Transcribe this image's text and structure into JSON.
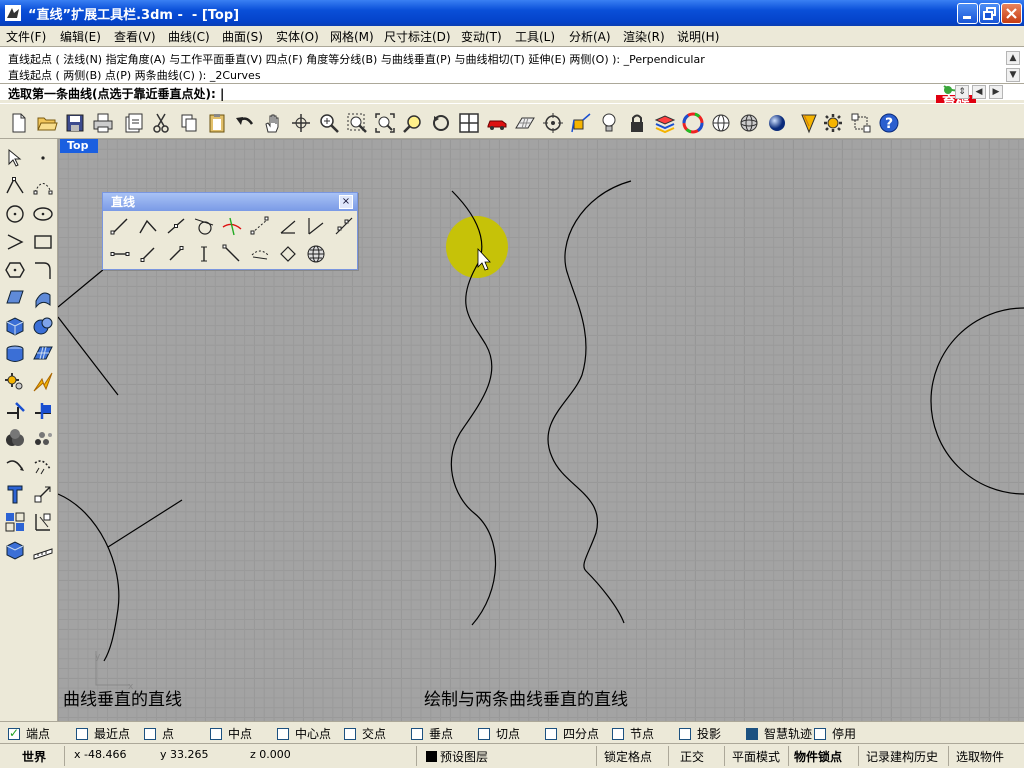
{
  "window": {
    "title": "“直线”扩展工具栏.3dm -  - [Top]",
    "icon": "rhino-icon"
  },
  "menu": [
    "文件(F)",
    "编辑(E)",
    "查看(V)",
    "曲线(C)",
    "曲面(S)",
    "实体(O)",
    "网格(M)",
    "尺寸标注(D)",
    "变动(T)",
    "工具(L)",
    "分析(A)",
    "渲染(R)",
    "说明(H)"
  ],
  "command": {
    "history1": "直线起点 ( 法线(N) 指定角度(A) 与工作平面垂直(V) 四点(F) 角度等分线(B) 与曲线垂直(P) 与曲线相切(T) 延伸(E) 两侧(O) ): _Perpendicular",
    "history2": "直线起点 ( 两侧(B) 点(P) 两条曲线(C) ): _2Curves",
    "prompt": "选取第一条曲线(点选于靠近垂直点处):"
  },
  "logo": {
    "line1": "育碟",
    "line2": "软件"
  },
  "viewport": {
    "tab": "Top",
    "label_left": "曲线垂直的直线",
    "label_center": "绘制与两条曲线垂直的直线",
    "axis_y": "y",
    "axis_x": "x"
  },
  "panel": {
    "title": "直线",
    "close": "×"
  },
  "osnap": [
    {
      "label": "端点",
      "checked": true
    },
    {
      "label": "最近点",
      "checked": false
    },
    {
      "label": "点",
      "checked": false
    },
    {
      "label": "中点",
      "checked": false
    },
    {
      "label": "中心点",
      "checked": false
    },
    {
      "label": "交点",
      "checked": false
    },
    {
      "label": "垂点",
      "checked": false
    },
    {
      "label": "切点",
      "checked": false
    },
    {
      "label": "四分点",
      "checked": false
    },
    {
      "label": "节点",
      "checked": false
    },
    {
      "label": "投影",
      "checked": false
    },
    {
      "label": "智慧轨迹",
      "checked": true
    },
    {
      "label": "停用",
      "checked": false
    }
  ],
  "status": {
    "cplane": "世界",
    "x": "x -48.466",
    "y": "y 33.265",
    "z": "z 0.000",
    "layer": "预设图层",
    "snap": "锁定格点",
    "ortho": "正交",
    "planar": "平面模式",
    "osnap": "物件锁点",
    "history": "记录建构历史",
    "filter": "选取物件"
  }
}
